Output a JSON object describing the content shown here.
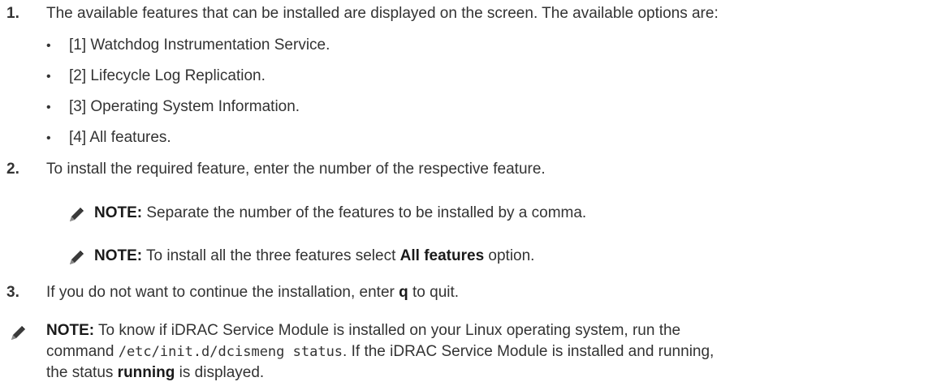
{
  "steps": [
    {
      "num": "1.",
      "text": "The available features that can be installed are displayed on the screen. The available options are:"
    },
    {
      "num": "2.",
      "text": "To install the required feature, enter the number of the respective feature."
    },
    {
      "num": "3.",
      "text_before": "If you do not want to continue the installation, enter ",
      "bold": "q",
      "text_after": " to quit."
    }
  ],
  "options": [
    "[1] Watchdog Instrumentation Service.",
    "[2] Lifecycle Log Replication.",
    "[3] Operating System Information.",
    "[4] All features."
  ],
  "notes": {
    "label": "NOTE:",
    "note1": " Separate the number of the features to be installed by a comma.",
    "note2_before": " To install all the three features select ",
    "note2_bold": "All features",
    "note2_after": " option.",
    "note3_line1": " To know if iDRAC Service Module is installed on your Linux operating system, run the",
    "note3_line2_before": "command ",
    "note3_code": "/etc/init.d/dcismeng status",
    "note3_line2_after": ". If the iDRAC Service Module is installed and running,",
    "note3_line3_before": "the status ",
    "note3_bold": "running",
    "note3_line3_after": " is displayed."
  },
  "icons": {
    "note": "pencil-icon"
  }
}
